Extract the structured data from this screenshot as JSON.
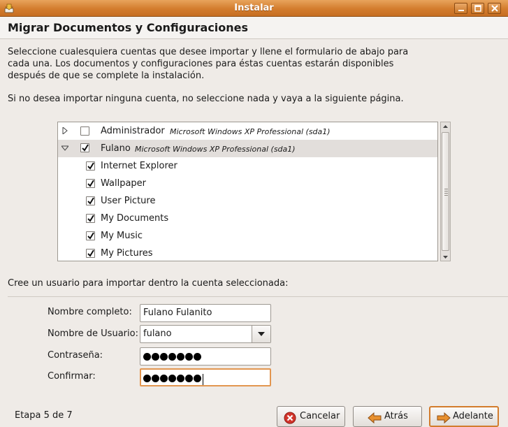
{
  "window": {
    "title": "Instalar"
  },
  "page": {
    "title": "Migrar Documentos y Configuraciones",
    "intro": "Seleccione cualesquiera cuentas que desee importar y llene el formulario de abajo para cada una. Los documentos y configuraciones para éstas cuentas estarán disponibles después de que se complete la instalación.",
    "hint": "Si no desea importar ninguna cuenta, no seleccione nada y vaya a la siguiente página."
  },
  "accounts": [
    {
      "name": "Administrador",
      "os": "Microsoft Windows XP Professional (sda1)",
      "checked": false,
      "expanded": false
    },
    {
      "name": "Fulano",
      "os": "Microsoft Windows XP Professional (sda1)",
      "checked": true,
      "expanded": true,
      "selected": true
    }
  ],
  "import_items": [
    {
      "label": "Internet Explorer",
      "checked": true
    },
    {
      "label": "Wallpaper",
      "checked": true
    },
    {
      "label": "User Picture",
      "checked": true
    },
    {
      "label": "My Documents",
      "checked": true
    },
    {
      "label": "My Music",
      "checked": true
    },
    {
      "label": "My Pictures",
      "checked": true
    }
  ],
  "form": {
    "intro": "Cree un usuario para importar dentro la cuenta seleccionada:",
    "full_name": {
      "label": "Nombre completo:",
      "value": "Fulano Fulanito"
    },
    "username": {
      "label": "Nombre de Usuario:",
      "value": "fulano"
    },
    "password": {
      "label": "Contraseña:",
      "length": 7
    },
    "confirm": {
      "label": "Confirmar:",
      "length": 7
    }
  },
  "footer": {
    "stage": "Etapa 5 de 7",
    "cancel": "Cancelar",
    "back": "Atrás",
    "forward": "Adelante"
  },
  "colors": {
    "titlebar": "#d37c2d",
    "focus": "#e29650",
    "cancel_icon": "#d2352c",
    "arrow_icon": "#e8902e"
  },
  "icons": {
    "app": "install-icon",
    "minimize": "minimize-icon",
    "maximize": "maximize-icon",
    "close": "close-icon",
    "cancel": "cancel-icon",
    "back": "arrow-left-icon",
    "forward": "arrow-right-icon"
  }
}
